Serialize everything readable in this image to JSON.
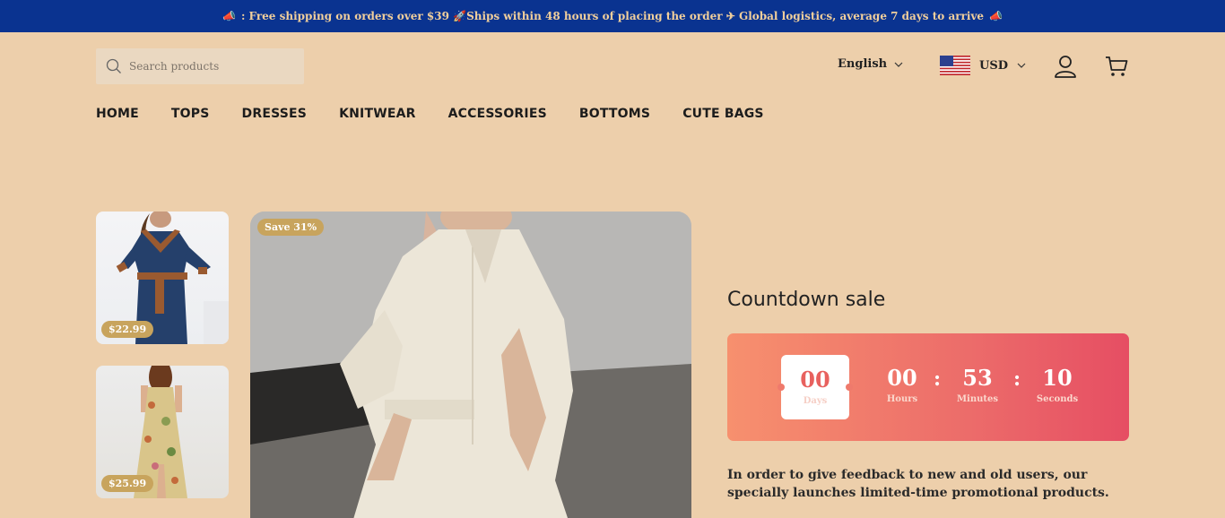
{
  "announcement": {
    "text": ": Free shipping on orders over $39 🚀Ships within 48 hours of placing the order ✈ Global logistics, average 7 days to arrive"
  },
  "header": {
    "search_placeholder": "Search products",
    "language": "English",
    "currency": "USD"
  },
  "nav": {
    "items": [
      "HOME",
      "TOPS",
      "DRESSES",
      "KNITWEAR",
      "ACCESSORIES",
      "BOTTOMS",
      "CUTE BAGS"
    ]
  },
  "thumbnails": [
    {
      "price": "$22.99"
    },
    {
      "price": "$25.99"
    }
  ],
  "hero": {
    "badge": "Save 31%"
  },
  "countdown": {
    "title": "Countdown sale",
    "days": {
      "value": "00",
      "label": "Days"
    },
    "hours": {
      "value": "00",
      "label": "Hours"
    },
    "minutes": {
      "value": "53",
      "label": "Minutes"
    },
    "seconds": {
      "value": "10",
      "label": "Seconds"
    },
    "separator": ":"
  },
  "promo": {
    "text": "In order to give feedback to new and old users, our specially launches limited-time promotional products."
  },
  "colors": {
    "background": "#edcfab",
    "announcement_bar": "#0a3390",
    "accent_gold": "#c8a45d",
    "countdown_start": "#f7906e",
    "countdown_end": "#e64e63"
  }
}
